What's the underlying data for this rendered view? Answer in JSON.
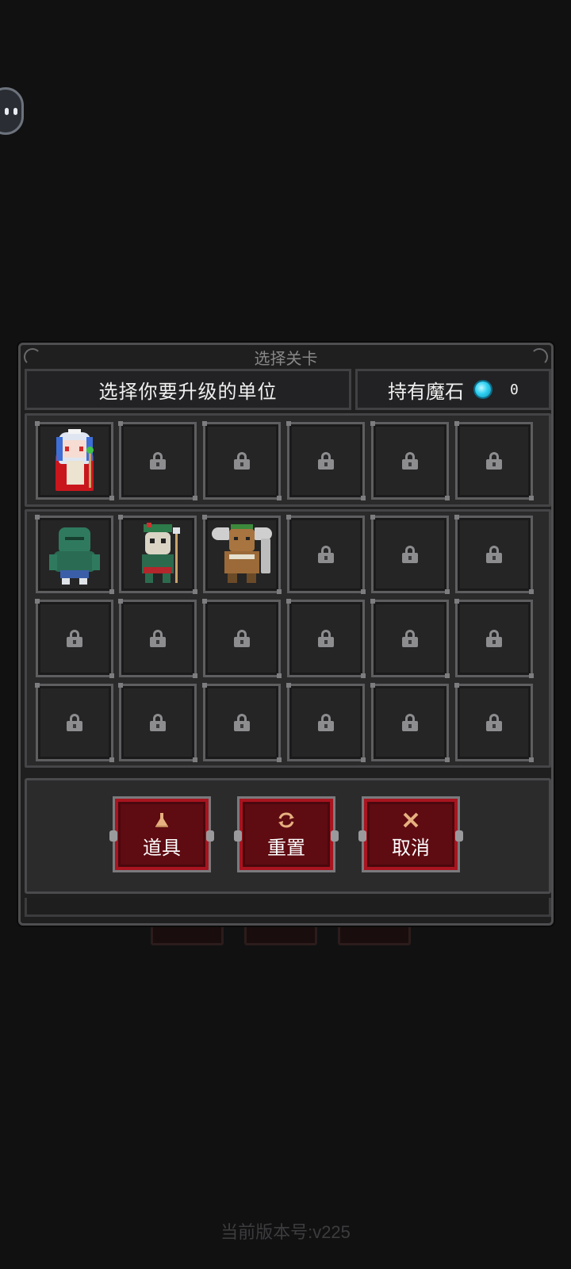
{
  "dialog": {
    "title": "选择关卡",
    "instruction": "选择你要升级的单位",
    "currency_label": "持有魔石",
    "currency_icon": "blue-gem-icon",
    "currency_count": "0"
  },
  "slots": {
    "top_row": [
      "hero-white-haired-mage",
      "locked",
      "locked",
      "locked",
      "locked",
      "locked"
    ],
    "grid_rows": [
      [
        "green-zombie",
        "masked-tribal-warrior",
        "horned-orc-warrior",
        "locked",
        "locked",
        "locked"
      ],
      [
        "locked",
        "locked",
        "locked",
        "locked",
        "locked",
        "locked"
      ],
      [
        "locked",
        "locked",
        "locked",
        "locked",
        "locked",
        "locked"
      ]
    ]
  },
  "actions": {
    "items_label": "道具",
    "reset_label": "重置",
    "cancel_label": "取消"
  },
  "footer": {
    "version": "当前版本号:v225"
  },
  "colors": {
    "background": "#111112",
    "panel": "#2a2a2b",
    "button_red": "#a8141f",
    "gem_blue": "#2fd1f2"
  }
}
